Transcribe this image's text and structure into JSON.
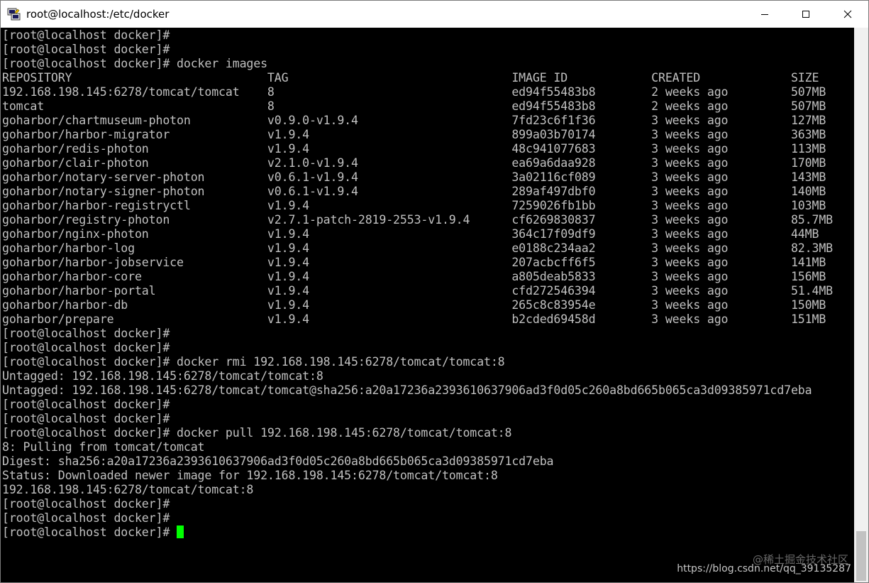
{
  "window": {
    "title": "root@localhost:/etc/docker"
  },
  "terminal": {
    "lines": [
      "[root@localhost docker]#",
      "[root@localhost docker]#",
      "[root@localhost docker]# docker images",
      "REPOSITORY                            TAG                                IMAGE ID            CREATED             SIZE",
      "192.168.198.145:6278/tomcat/tomcat    8                                  ed94f55483b8        2 weeks ago         507MB",
      "tomcat                                8                                  ed94f55483b8        2 weeks ago         507MB",
      "goharbor/chartmuseum-photon           v0.9.0-v1.9.4                      7fd23c6f1f36        3 weeks ago         127MB",
      "goharbor/harbor-migrator              v1.9.4                             899a03b70174        3 weeks ago         363MB",
      "goharbor/redis-photon                 v1.9.4                             48c941077683        3 weeks ago         113MB",
      "goharbor/clair-photon                 v2.1.0-v1.9.4                      ea69a6daa928        3 weeks ago         170MB",
      "goharbor/notary-server-photon         v0.6.1-v1.9.4                      3a02116cf089        3 weeks ago         143MB",
      "goharbor/notary-signer-photon         v0.6.1-v1.9.4                      289af497dbf0        3 weeks ago         140MB",
      "goharbor/harbor-registryctl           v1.9.4                             7259026fb1bb        3 weeks ago         103MB",
      "goharbor/registry-photon              v2.7.1-patch-2819-2553-v1.9.4      cf6269830837        3 weeks ago         85.7MB",
      "goharbor/nginx-photon                 v1.9.4                             364c17f09df9        3 weeks ago         44MB",
      "goharbor/harbor-log                   v1.9.4                             e0188c234aa2        3 weeks ago         82.3MB",
      "goharbor/harbor-jobservice            v1.9.4                             207acbcff6f5        3 weeks ago         141MB",
      "goharbor/harbor-core                  v1.9.4                             a805deab5833        3 weeks ago         156MB",
      "goharbor/harbor-portal                v1.9.4                             cfd272546394        3 weeks ago         51.4MB",
      "goharbor/harbor-db                    v1.9.4                             265c8c83954e        3 weeks ago         150MB",
      "goharbor/prepare                      v1.9.4                             b2cded69458d        3 weeks ago         151MB",
      "[root@localhost docker]#",
      "[root@localhost docker]#",
      "[root@localhost docker]# docker rmi 192.168.198.145:6278/tomcat/tomcat:8",
      "Untagged: 192.168.198.145:6278/tomcat/tomcat:8",
      "Untagged: 192.168.198.145:6278/tomcat/tomcat@sha256:a20a17236a2393610637906ad3f0d05c260a8bd665b065ca3d09385971cd7eba",
      "[root@localhost docker]#",
      "[root@localhost docker]#",
      "[root@localhost docker]# docker pull 192.168.198.145:6278/tomcat/tomcat:8",
      "8: Pulling from tomcat/tomcat",
      "Digest: sha256:a20a17236a2393610637906ad3f0d05c260a8bd665b065ca3d09385971cd7eba",
      "Status: Downloaded newer image for 192.168.198.145:6278/tomcat/tomcat:8",
      "192.168.198.145:6278/tomcat/tomcat:8",
      "[root@localhost docker]#",
      "[root@localhost docker]#"
    ],
    "prompt": "[root@localhost docker]# ",
    "cursor_color": "#00ff00",
    "text_color": "#c0c0c0",
    "background_color": "#000000"
  },
  "watermark": {
    "line1": "@稀土掘金技术社区",
    "line2": "https://blog.csdn.net/qq_39135287"
  },
  "icons": {
    "app": "putty-terminal-icon",
    "minimize": "minimize-icon",
    "maximize": "maximize-icon",
    "close": "close-icon"
  }
}
